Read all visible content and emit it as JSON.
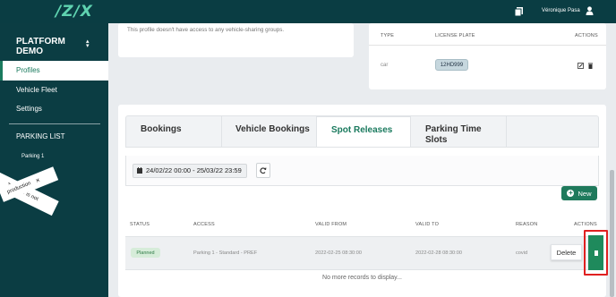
{
  "app": {
    "logo": "/Z/X"
  },
  "header": {
    "user_name": "Véronique Pasa"
  },
  "sidebar": {
    "org": "PLATFORM DEMO",
    "items": [
      {
        "label": "Profiles"
      },
      {
        "label": "Vehicle Fleet"
      },
      {
        "label": "Settings"
      }
    ],
    "section": "PARKING LIST",
    "parking_item": "Parking 1",
    "banner_line1": "This site is not",
    "banner_line2": "production"
  },
  "sharing_card": {
    "text": "This profile doesn't have access to any vehicle-sharing groups."
  },
  "vehicles_card": {
    "headers": {
      "type": "TYPE",
      "plate": "LICENSE PLATE",
      "actions": "ACTIONS"
    },
    "rows": [
      {
        "type": "car",
        "plate": "12HD999"
      }
    ]
  },
  "tabs": [
    "Bookings",
    "Vehicle Bookings",
    "Spot Releases",
    "Parking Time Slots"
  ],
  "active_tab": "Spot Releases",
  "filter": {
    "date_range": "24/02/22 00:00 - 25/03/22 23:59"
  },
  "new_button": "New",
  "table": {
    "headers": [
      "STATUS",
      "ACCESS",
      "VALID FROM",
      "VALID TO",
      "REASON",
      "ACTIONS"
    ],
    "rows": [
      {
        "status": "Planned",
        "access": "Parking 1 - Standard - PREF",
        "valid_from": "2022-02-25 08:30:00",
        "valid_to": "2022-02-28 08:30:00",
        "reason": "covid"
      }
    ],
    "delete_label": "Delete",
    "empty_text": "No more records to display..."
  },
  "colors": {
    "brand": "#0b3d43",
    "accent": "#1f7a5c",
    "highlight": "#e02020"
  }
}
